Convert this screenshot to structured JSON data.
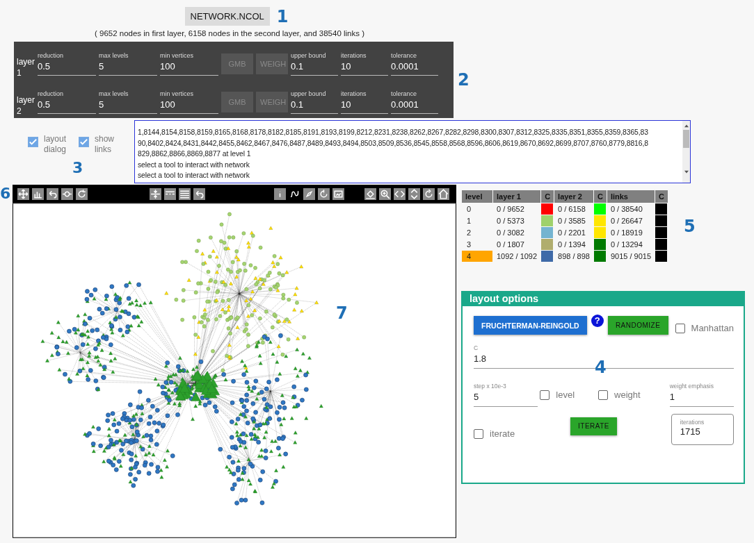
{
  "title_button": "NETWORK.NCOL",
  "summary": "( 9652 nodes in first layer, 6158 nodes in the second layer, and 38540 links )",
  "callouts": [
    "1",
    "2",
    "3",
    "4",
    "5",
    "6",
    "7"
  ],
  "layers": [
    {
      "label": "layer 1",
      "left_fields": [
        {
          "label": "reduction",
          "value": "0.5"
        },
        {
          "label": "max levels",
          "value": "5"
        },
        {
          "label": "min vertices",
          "value": "100"
        }
      ],
      "buttons": [
        {
          "label": "GMB",
          "disabled": true
        },
        {
          "label": "WEIGH",
          "disabled": true
        }
      ],
      "right_fields": [
        {
          "label": "upper bound",
          "value": "0.1"
        },
        {
          "label": "iterations",
          "value": "10"
        },
        {
          "label": "tolerance",
          "value": "0.0001"
        }
      ]
    },
    {
      "label": "layer 2",
      "left_fields": [
        {
          "label": "reduction",
          "value": "0.5"
        },
        {
          "label": "max levels",
          "value": "5"
        },
        {
          "label": "min vertices",
          "value": "100"
        }
      ],
      "buttons": [
        {
          "label": "GMB",
          "disabled": true
        },
        {
          "label": "WEIGH",
          "disabled": true
        }
      ],
      "right_fields": [
        {
          "label": "upper bound",
          "value": "0.1"
        },
        {
          "label": "iterations",
          "value": "10"
        },
        {
          "label": "tolerance",
          "value": "0.0001"
        }
      ]
    }
  ],
  "checkboxes": [
    {
      "label": "layout dialog",
      "checked": true
    },
    {
      "label": "show links",
      "checked": true
    }
  ],
  "log": [
    "1,8144,8154,8158,8159,8165,8168,8178,8182,8185,8191,8193,8199,8212,8231,8238,8262,8267,8282,8298,8300,8307,8312,8325,8335,8351,8355,8359,8365,83",
    "90,8402,8424,8431,8442,8455,8462,8467,8476,8487,8489,8493,8494,8503,8509,8536,8545,8558,8568,8596,8606,8619,8670,8692,8699,8707,8760,8779,8816,8",
    "829,8862,8866,8869,8877 at level 1",
    "select a tool to interact with network",
    "select a tool to interact with network"
  ],
  "table": {
    "columns": [
      "level",
      "layer 1",
      "C",
      "layer 2",
      "C",
      "links",
      "C"
    ],
    "rows": [
      {
        "level": "0",
        "selected": false,
        "cells": [
          {
            "kind": "count",
            "value": "0 / 9652"
          },
          {
            "kind": "swatch",
            "color": "#ff0000"
          },
          {
            "kind": "count",
            "value": "0 / 6158"
          },
          {
            "kind": "swatch",
            "color": "#00ff00"
          },
          {
            "kind": "count",
            "value": "0 / 38540"
          },
          {
            "kind": "swatch",
            "color": "#000000"
          }
        ]
      },
      {
        "level": "1",
        "selected": false,
        "cells": [
          {
            "kind": "count",
            "value": "0 / 5373"
          },
          {
            "kind": "swatch",
            "color": "#9fd16b"
          },
          {
            "kind": "count",
            "value": "0 / 3585"
          },
          {
            "kind": "swatch",
            "color": "#ffe600"
          },
          {
            "kind": "count",
            "value": "0 / 26647"
          },
          {
            "kind": "swatch",
            "color": "#000000"
          }
        ]
      },
      {
        "level": "2",
        "selected": false,
        "cells": [
          {
            "kind": "count",
            "value": "0 / 3082"
          },
          {
            "kind": "swatch",
            "color": "#74b4d0"
          },
          {
            "kind": "count",
            "value": "0 / 2201"
          },
          {
            "kind": "swatch",
            "color": "#ffe600"
          },
          {
            "kind": "count",
            "value": "0 / 18919"
          },
          {
            "kind": "swatch",
            "color": "#000000"
          }
        ]
      },
      {
        "level": "3",
        "selected": false,
        "cells": [
          {
            "kind": "count",
            "value": "0 / 1807"
          },
          {
            "kind": "swatch",
            "color": "#b0ad6e"
          },
          {
            "kind": "count",
            "value": "0 / 1394"
          },
          {
            "kind": "swatch",
            "color": "#007a00"
          },
          {
            "kind": "count",
            "value": "0 / 13294"
          },
          {
            "kind": "swatch",
            "color": "#000000"
          }
        ]
      },
      {
        "level": "4",
        "selected": true,
        "cells": [
          {
            "kind": "count",
            "value": "1092 / 1092"
          },
          {
            "kind": "swatch",
            "color": "#3f6aa8"
          },
          {
            "kind": "count",
            "value": "898 / 898"
          },
          {
            "kind": "swatch",
            "color": "#007a00"
          },
          {
            "kind": "count",
            "value": "9015 / 9015"
          },
          {
            "kind": "swatch",
            "color": "#000000"
          }
        ]
      }
    ]
  },
  "layout_options": {
    "title": "layout options",
    "primary_button": "FRUCHTERMAN-REINGOLD",
    "help": "?",
    "randomize_button": "RANDOMIZE",
    "manhattan": {
      "label": "Manhattan",
      "checked": false
    },
    "c_field": {
      "label": "C",
      "value": "1.8"
    },
    "step_field": {
      "label": "step x 10e-3",
      "value": "5"
    },
    "level": {
      "label": "level",
      "checked": false
    },
    "weight": {
      "label": "weight",
      "checked": false
    },
    "weight_emphasis": {
      "label": "weight emphasis",
      "value": "1"
    },
    "iterate": {
      "label": "iterate",
      "checked": false
    },
    "iterate_button": "ITERATE",
    "iterations_field": {
      "label": "iterations",
      "value": "1715"
    }
  }
}
